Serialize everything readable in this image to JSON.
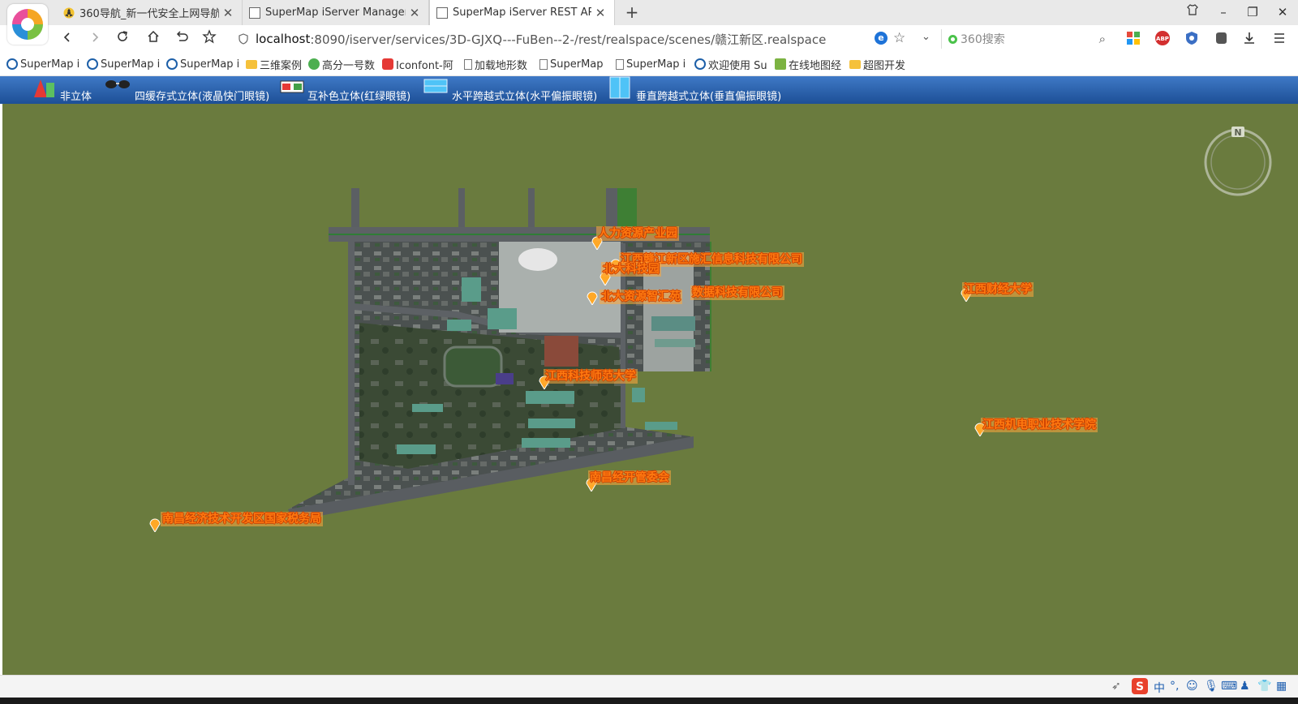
{
  "tabs": [
    {
      "title": "360导航_新一代安全上网导航",
      "active": false
    },
    {
      "title": "SuperMap iServer Manager",
      "active": false
    },
    {
      "title": "SuperMap iServer REST API",
      "active": true
    }
  ],
  "address": {
    "host": "localhost",
    "path": ":8090/iserver/services/3D-GJXQ---FuBen--2-/rest/realspace/scenes/赣江新区.realspace"
  },
  "search": {
    "placeholder": "360搜索"
  },
  "bookmarks": [
    {
      "label": "SuperMap i",
      "icon": "supermap-icon"
    },
    {
      "label": "SuperMap i",
      "icon": "supermap-icon"
    },
    {
      "label": "SuperMap i",
      "icon": "supermap-icon"
    },
    {
      "label": "三维案例",
      "icon": "folder-icon"
    },
    {
      "label": "高分一号数",
      "icon": "globe-icon"
    },
    {
      "label": "Iconfont-阿",
      "icon": "iconfont-icon"
    },
    {
      "label": "加载地形数",
      "icon": "file-icon"
    },
    {
      "label": "SuperMap",
      "icon": "file-icon"
    },
    {
      "label": "SuperMap i",
      "icon": "file-icon"
    },
    {
      "label": "欢迎使用 Su",
      "icon": "supermap-icon"
    },
    {
      "label": "在线地图经",
      "icon": "map-icon"
    },
    {
      "label": "超图开发",
      "icon": "folder-icon"
    }
  ],
  "stereo_modes": [
    {
      "label": "非立体",
      "icon": "mono-cone-icon"
    },
    {
      "label": "四缓存式立体(液晶快门眼镜)",
      "icon": "shutter-glasses-icon"
    },
    {
      "label": "互补色立体(红绿眼镜)",
      "icon": "anaglyph-glasses-icon"
    },
    {
      "label": "水平跨越式立体(水平偏振眼镜)",
      "icon": "horizontal-polarized-icon"
    },
    {
      "label": "垂直跨越式立体(垂直偏振眼镜)",
      "icon": "vertical-polarized-icon"
    }
  ],
  "scene": {
    "ground_color": "#6a7b3e",
    "label_color": "#ff7a10",
    "compass_label": "N",
    "pois": [
      "人力资源产业园",
      "江西赣江新区施汇信息科技有限公司",
      "北大科技园",
      "北大资源智汇苑",
      "数据科技有限公司",
      "江西财经大学",
      "江西科技师范大学",
      "江西机电职业技术学院",
      "南昌经开管委会",
      "南昌经济技术开发区国家税务局"
    ]
  },
  "tray": {
    "ime": "中"
  }
}
